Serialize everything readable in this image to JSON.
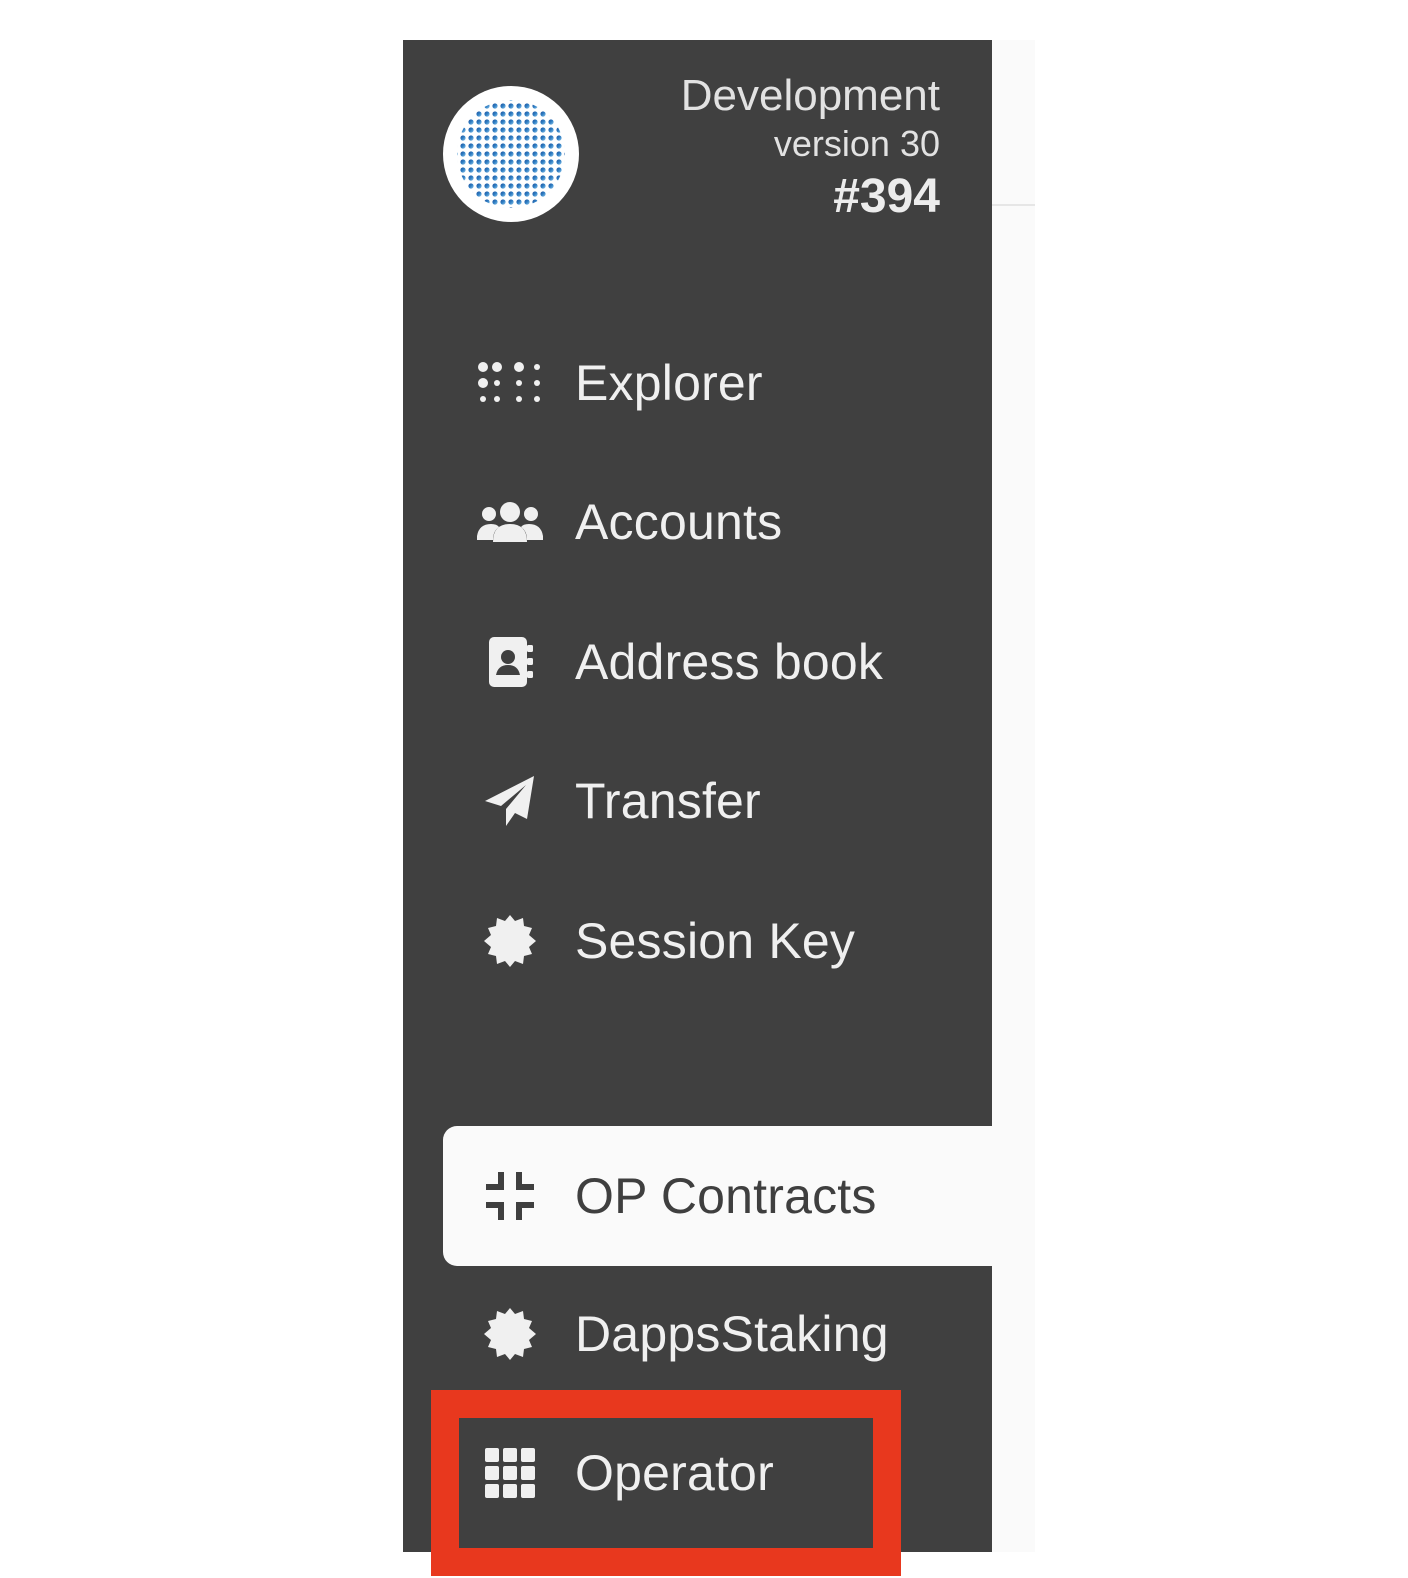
{
  "chain": {
    "name": "Development",
    "version": "version 30",
    "block": "#394"
  },
  "nav": {
    "items": [
      {
        "label": "Explorer",
        "icon": "explorer-icon"
      },
      {
        "label": "Accounts",
        "icon": "users-icon"
      },
      {
        "label": "Address book",
        "icon": "address-book-icon"
      },
      {
        "label": "Transfer",
        "icon": "paper-plane-icon"
      },
      {
        "label": "Session Key",
        "icon": "certificate-icon"
      },
      {
        "label": "OP Contracts",
        "icon": "compress-icon",
        "active": true
      },
      {
        "label": "DappsStaking",
        "icon": "certificate-icon"
      },
      {
        "label": "Operator",
        "icon": "grid-icon",
        "highlighted": true
      }
    ]
  },
  "colors": {
    "sidebar_bg": "#404040",
    "active_bg": "#fafafa",
    "highlight": "#e8381e",
    "text": "#f0f0f0"
  }
}
